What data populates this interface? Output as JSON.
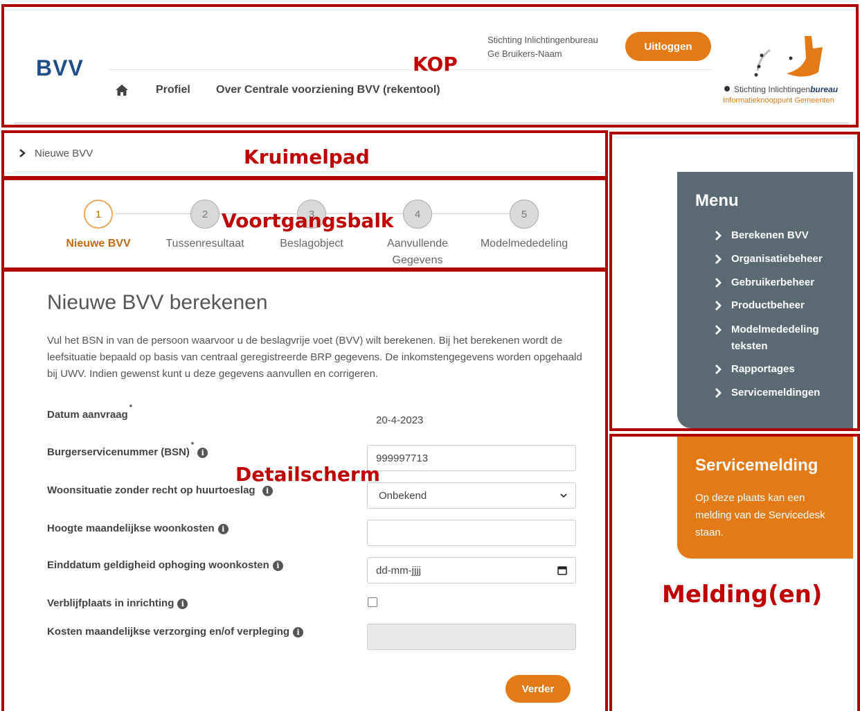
{
  "header": {
    "brand": "BVV",
    "nav": {
      "profile": "Profiel",
      "about": "Over Centrale voorziening BVV (rekentool)"
    },
    "org_name": "Stichting Inlichtingenbureau",
    "user_name": "Ge Bruikers-Naam",
    "logout_label": "Uitloggen",
    "logo_line1_prefix": "Stichting Inlichtingen",
    "logo_line1_italic": "bureau",
    "logo_line2": "Informatieknooppunt Gemeenten"
  },
  "breadcrumb": {
    "current": "Nieuwe BVV"
  },
  "progress": {
    "steps": [
      {
        "number": "1",
        "label": "Nieuwe BVV"
      },
      {
        "number": "2",
        "label": "Tussenresultaat"
      },
      {
        "number": "3",
        "label": "Beslagobject"
      },
      {
        "number": "4",
        "label": "Aanvullende Gegevens"
      },
      {
        "number": "5",
        "label": "Modelmededeling"
      }
    ],
    "active_step": 1
  },
  "detail": {
    "title": "Nieuwe BVV berekenen",
    "intro": "Vul het BSN in van de persoon waarvoor u de beslagvrije voet (BVV) wilt berekenen. Bij het berekenen wordt de leefsituatie bepaald op basis van centraal geregistreerde BRP gegevens. De inkomstengegevens worden opgehaald bij UWV. Indien gewenst kunt u deze gegevens aanvullen en corrigeren.",
    "fields": {
      "datum_label": "Datum aanvraag",
      "datum_value": "20-4-2023",
      "bsn_label": "Burgerservicenummer (BSN)",
      "bsn_value": "999997713",
      "woon_label": "Woonsituatie zonder recht op huurtoeslag",
      "woon_value": "Onbekend",
      "hoogte_label": "Hoogte maandelijkse woonkosten",
      "hoogte_value": "",
      "eind_label": "Einddatum geldigheid ophoging woonkosten",
      "eind_placeholder": "dd-mm-jjjj",
      "verblijf_label": "Verblijfplaats in inrichting",
      "verblijf_checked": false,
      "kosten_label": "Kosten maandelijkse verzorging en/of verpleging"
    },
    "required_mark": "*",
    "info_glyph": "i",
    "next_label": "Verder"
  },
  "menu": {
    "title": "Menu",
    "items": [
      "Berekenen BVV",
      "Organisatiebeheer",
      "Gebruikerbeheer",
      "Productbeheer",
      "Modelmededeling teksten",
      "Rapportages",
      "Servicemeldingen"
    ]
  },
  "service": {
    "title": "Servicemelding",
    "text": "Op deze plaats kan een melding van de Servicedesk staan."
  },
  "annotations": {
    "kop": "KOP",
    "kruimelpad": "Kruimelpad",
    "voortgangsbalk": "Voortgangsbalk",
    "detailscherm": "Detailscherm",
    "meldingen": "Melding(en)"
  },
  "colors": {
    "accent": "#e37a15",
    "menu_bg": "#5a6a73",
    "annotation": "#c00000",
    "brand": "#1f4e8c"
  }
}
